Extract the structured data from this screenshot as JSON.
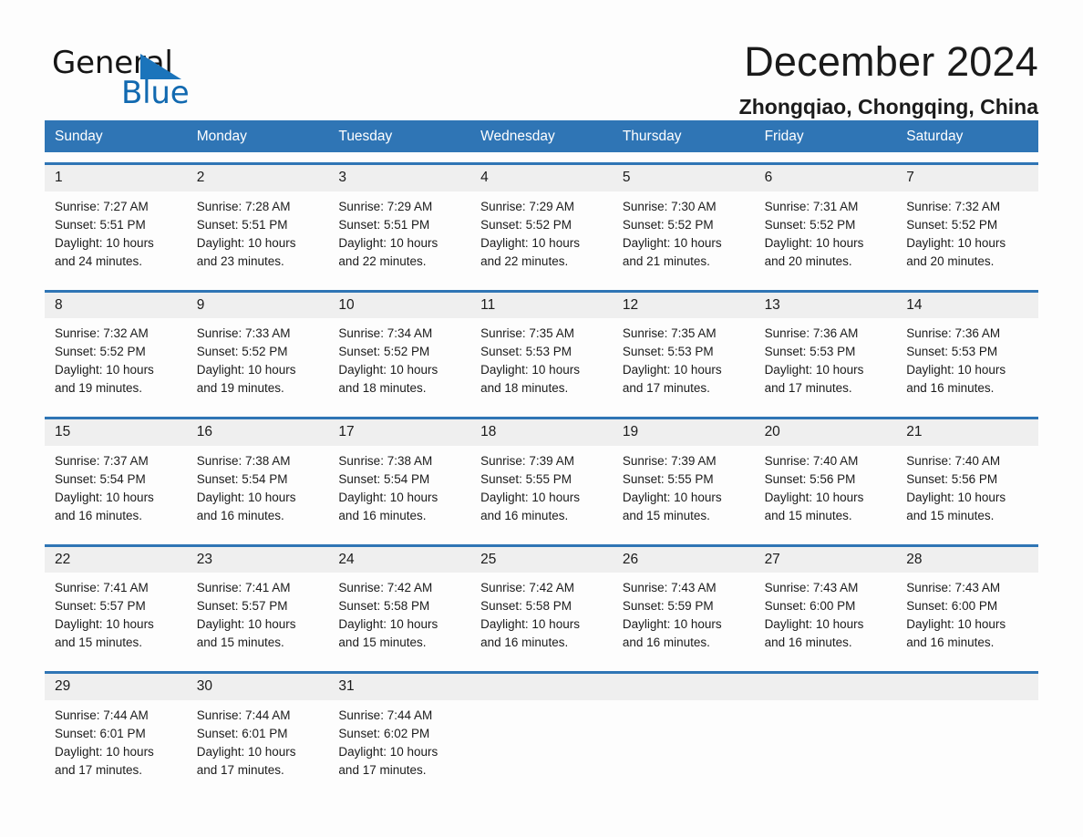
{
  "brand": {
    "name_part1": "General",
    "name_part2": "Blue",
    "triangle_color": "#1b74bb",
    "blue_color": "#1169b0"
  },
  "header": {
    "title": "December 2024",
    "subtitle": "Zhongqiao, Chongqing, China"
  },
  "theme": {
    "header_blue": "#2f75b5",
    "daynum_band": "#efefef",
    "page_bg": "#fdfdfd"
  },
  "calendar": {
    "weekdays": [
      "Sunday",
      "Monday",
      "Tuesday",
      "Wednesday",
      "Thursday",
      "Friday",
      "Saturday"
    ],
    "weeks": [
      {
        "daynums": [
          "1",
          "2",
          "3",
          "4",
          "5",
          "6",
          "7"
        ],
        "cells": [
          {
            "sunrise": "Sunrise: 7:27 AM",
            "sunset": "Sunset: 5:51 PM",
            "daylight1": "Daylight: 10 hours",
            "daylight2": "and 24 minutes."
          },
          {
            "sunrise": "Sunrise: 7:28 AM",
            "sunset": "Sunset: 5:51 PM",
            "daylight1": "Daylight: 10 hours",
            "daylight2": "and 23 minutes."
          },
          {
            "sunrise": "Sunrise: 7:29 AM",
            "sunset": "Sunset: 5:51 PM",
            "daylight1": "Daylight: 10 hours",
            "daylight2": "and 22 minutes."
          },
          {
            "sunrise": "Sunrise: 7:29 AM",
            "sunset": "Sunset: 5:52 PM",
            "daylight1": "Daylight: 10 hours",
            "daylight2": "and 22 minutes."
          },
          {
            "sunrise": "Sunrise: 7:30 AM",
            "sunset": "Sunset: 5:52 PM",
            "daylight1": "Daylight: 10 hours",
            "daylight2": "and 21 minutes."
          },
          {
            "sunrise": "Sunrise: 7:31 AM",
            "sunset": "Sunset: 5:52 PM",
            "daylight1": "Daylight: 10 hours",
            "daylight2": "and 20 minutes."
          },
          {
            "sunrise": "Sunrise: 7:32 AM",
            "sunset": "Sunset: 5:52 PM",
            "daylight1": "Daylight: 10 hours",
            "daylight2": "and 20 minutes."
          }
        ]
      },
      {
        "daynums": [
          "8",
          "9",
          "10",
          "11",
          "12",
          "13",
          "14"
        ],
        "cells": [
          {
            "sunrise": "Sunrise: 7:32 AM",
            "sunset": "Sunset: 5:52 PM",
            "daylight1": "Daylight: 10 hours",
            "daylight2": "and 19 minutes."
          },
          {
            "sunrise": "Sunrise: 7:33 AM",
            "sunset": "Sunset: 5:52 PM",
            "daylight1": "Daylight: 10 hours",
            "daylight2": "and 19 minutes."
          },
          {
            "sunrise": "Sunrise: 7:34 AM",
            "sunset": "Sunset: 5:52 PM",
            "daylight1": "Daylight: 10 hours",
            "daylight2": "and 18 minutes."
          },
          {
            "sunrise": "Sunrise: 7:35 AM",
            "sunset": "Sunset: 5:53 PM",
            "daylight1": "Daylight: 10 hours",
            "daylight2": "and 18 minutes."
          },
          {
            "sunrise": "Sunrise: 7:35 AM",
            "sunset": "Sunset: 5:53 PM",
            "daylight1": "Daylight: 10 hours",
            "daylight2": "and 17 minutes."
          },
          {
            "sunrise": "Sunrise: 7:36 AM",
            "sunset": "Sunset: 5:53 PM",
            "daylight1": "Daylight: 10 hours",
            "daylight2": "and 17 minutes."
          },
          {
            "sunrise": "Sunrise: 7:36 AM",
            "sunset": "Sunset: 5:53 PM",
            "daylight1": "Daylight: 10 hours",
            "daylight2": "and 16 minutes."
          }
        ]
      },
      {
        "daynums": [
          "15",
          "16",
          "17",
          "18",
          "19",
          "20",
          "21"
        ],
        "cells": [
          {
            "sunrise": "Sunrise: 7:37 AM",
            "sunset": "Sunset: 5:54 PM",
            "daylight1": "Daylight: 10 hours",
            "daylight2": "and 16 minutes."
          },
          {
            "sunrise": "Sunrise: 7:38 AM",
            "sunset": "Sunset: 5:54 PM",
            "daylight1": "Daylight: 10 hours",
            "daylight2": "and 16 minutes."
          },
          {
            "sunrise": "Sunrise: 7:38 AM",
            "sunset": "Sunset: 5:54 PM",
            "daylight1": "Daylight: 10 hours",
            "daylight2": "and 16 minutes."
          },
          {
            "sunrise": "Sunrise: 7:39 AM",
            "sunset": "Sunset: 5:55 PM",
            "daylight1": "Daylight: 10 hours",
            "daylight2": "and 16 minutes."
          },
          {
            "sunrise": "Sunrise: 7:39 AM",
            "sunset": "Sunset: 5:55 PM",
            "daylight1": "Daylight: 10 hours",
            "daylight2": "and 15 minutes."
          },
          {
            "sunrise": "Sunrise: 7:40 AM",
            "sunset": "Sunset: 5:56 PM",
            "daylight1": "Daylight: 10 hours",
            "daylight2": "and 15 minutes."
          },
          {
            "sunrise": "Sunrise: 7:40 AM",
            "sunset": "Sunset: 5:56 PM",
            "daylight1": "Daylight: 10 hours",
            "daylight2": "and 15 minutes."
          }
        ]
      },
      {
        "daynums": [
          "22",
          "23",
          "24",
          "25",
          "26",
          "27",
          "28"
        ],
        "cells": [
          {
            "sunrise": "Sunrise: 7:41 AM",
            "sunset": "Sunset: 5:57 PM",
            "daylight1": "Daylight: 10 hours",
            "daylight2": "and 15 minutes."
          },
          {
            "sunrise": "Sunrise: 7:41 AM",
            "sunset": "Sunset: 5:57 PM",
            "daylight1": "Daylight: 10 hours",
            "daylight2": "and 15 minutes."
          },
          {
            "sunrise": "Sunrise: 7:42 AM",
            "sunset": "Sunset: 5:58 PM",
            "daylight1": "Daylight: 10 hours",
            "daylight2": "and 15 minutes."
          },
          {
            "sunrise": "Sunrise: 7:42 AM",
            "sunset": "Sunset: 5:58 PM",
            "daylight1": "Daylight: 10 hours",
            "daylight2": "and 16 minutes."
          },
          {
            "sunrise": "Sunrise: 7:43 AM",
            "sunset": "Sunset: 5:59 PM",
            "daylight1": "Daylight: 10 hours",
            "daylight2": "and 16 minutes."
          },
          {
            "sunrise": "Sunrise: 7:43 AM",
            "sunset": "Sunset: 6:00 PM",
            "daylight1": "Daylight: 10 hours",
            "daylight2": "and 16 minutes."
          },
          {
            "sunrise": "Sunrise: 7:43 AM",
            "sunset": "Sunset: 6:00 PM",
            "daylight1": "Daylight: 10 hours",
            "daylight2": "and 16 minutes."
          }
        ]
      },
      {
        "daynums": [
          "29",
          "30",
          "31",
          "",
          "",
          "",
          ""
        ],
        "cells": [
          {
            "sunrise": "Sunrise: 7:44 AM",
            "sunset": "Sunset: 6:01 PM",
            "daylight1": "Daylight: 10 hours",
            "daylight2": "and 17 minutes."
          },
          {
            "sunrise": "Sunrise: 7:44 AM",
            "sunset": "Sunset: 6:01 PM",
            "daylight1": "Daylight: 10 hours",
            "daylight2": "and 17 minutes."
          },
          {
            "sunrise": "Sunrise: 7:44 AM",
            "sunset": "Sunset: 6:02 PM",
            "daylight1": "Daylight: 10 hours",
            "daylight2": "and 17 minutes."
          },
          {
            "sunrise": "",
            "sunset": "",
            "daylight1": "",
            "daylight2": ""
          },
          {
            "sunrise": "",
            "sunset": "",
            "daylight1": "",
            "daylight2": ""
          },
          {
            "sunrise": "",
            "sunset": "",
            "daylight1": "",
            "daylight2": ""
          },
          {
            "sunrise": "",
            "sunset": "",
            "daylight1": "",
            "daylight2": ""
          }
        ]
      }
    ]
  }
}
